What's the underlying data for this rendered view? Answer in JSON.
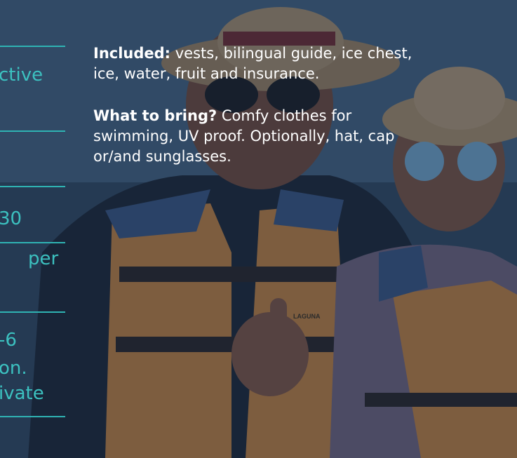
{
  "left_column": {
    "line_1": "ctive",
    "line_2": "30",
    "line_3": "per",
    "line_4": "-6",
    "line_5": "on.",
    "line_6": "ivate"
  },
  "info": {
    "included": {
      "label": "Included:",
      "text": " vests, bilingual guide, ice chest, ice, water, fruit and insurance."
    },
    "bring": {
      "label": "What to bring?",
      "text": " Comfy clothes for swimming, UV proof. Optionally, hat, cap or/and sunglasses."
    }
  },
  "photo": {
    "vest_brand": "LAGUNA",
    "colors": {
      "overlay": "#142642",
      "teal_accent": "#2fb3b3",
      "vest_orange": "#d48a3c",
      "sky": "#4b6a82"
    }
  }
}
